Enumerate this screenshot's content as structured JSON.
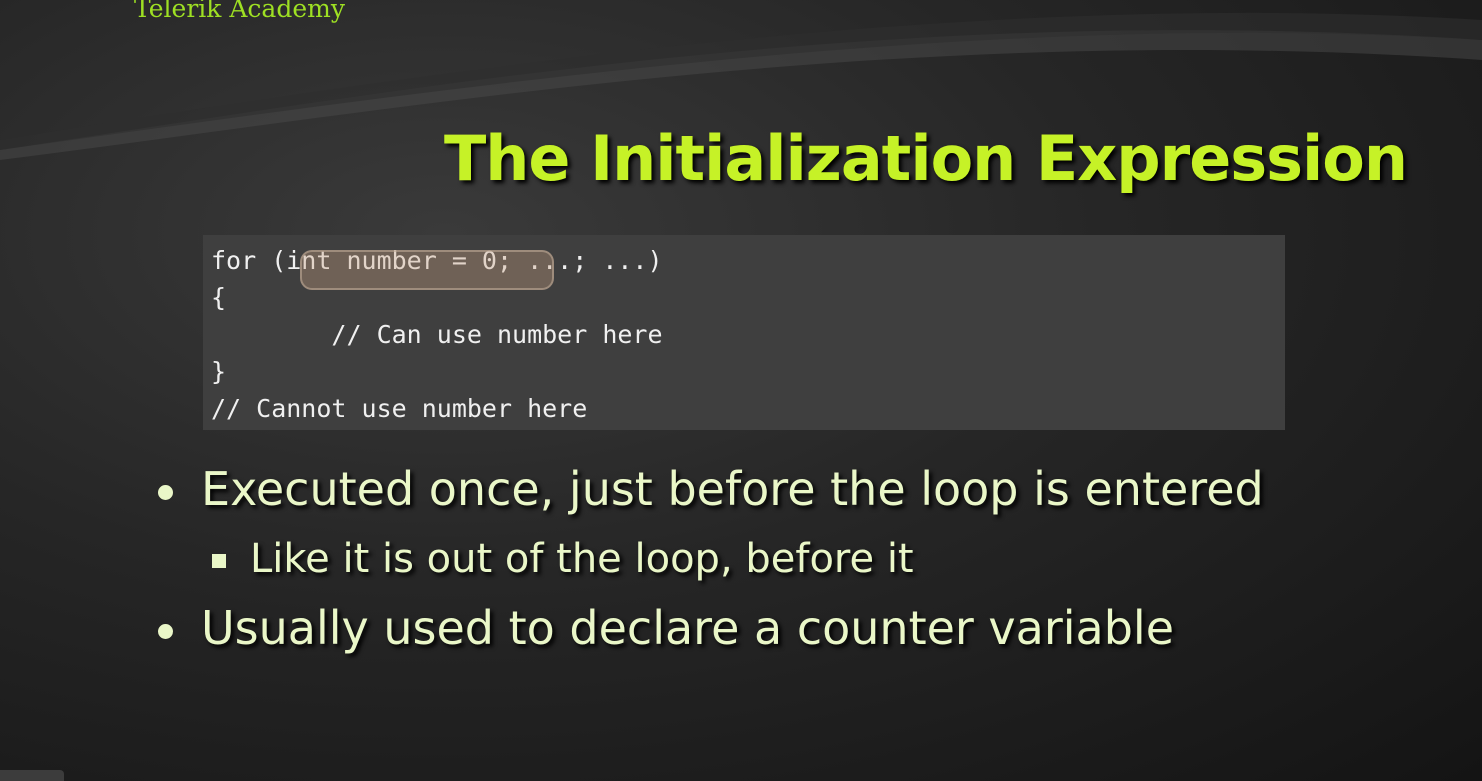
{
  "logo": "Telerik Academy",
  "title": "The Initialization Expression",
  "code": [
    "for (int number = 0; ...; ...)",
    "{",
    "        // Can use number here",
    "}",
    "// Cannot use number here"
  ],
  "bullets": [
    {
      "text": "Executed once, just before the loop is entered",
      "sub": [
        "Like it is out of the loop, before it"
      ]
    },
    {
      "text": "Usually used to declare a counter variable"
    }
  ],
  "colors": {
    "title": "#c6f227",
    "logo": "#9ee023",
    "text": "#eaf7c8",
    "code_bg": "#3f3f3f"
  }
}
